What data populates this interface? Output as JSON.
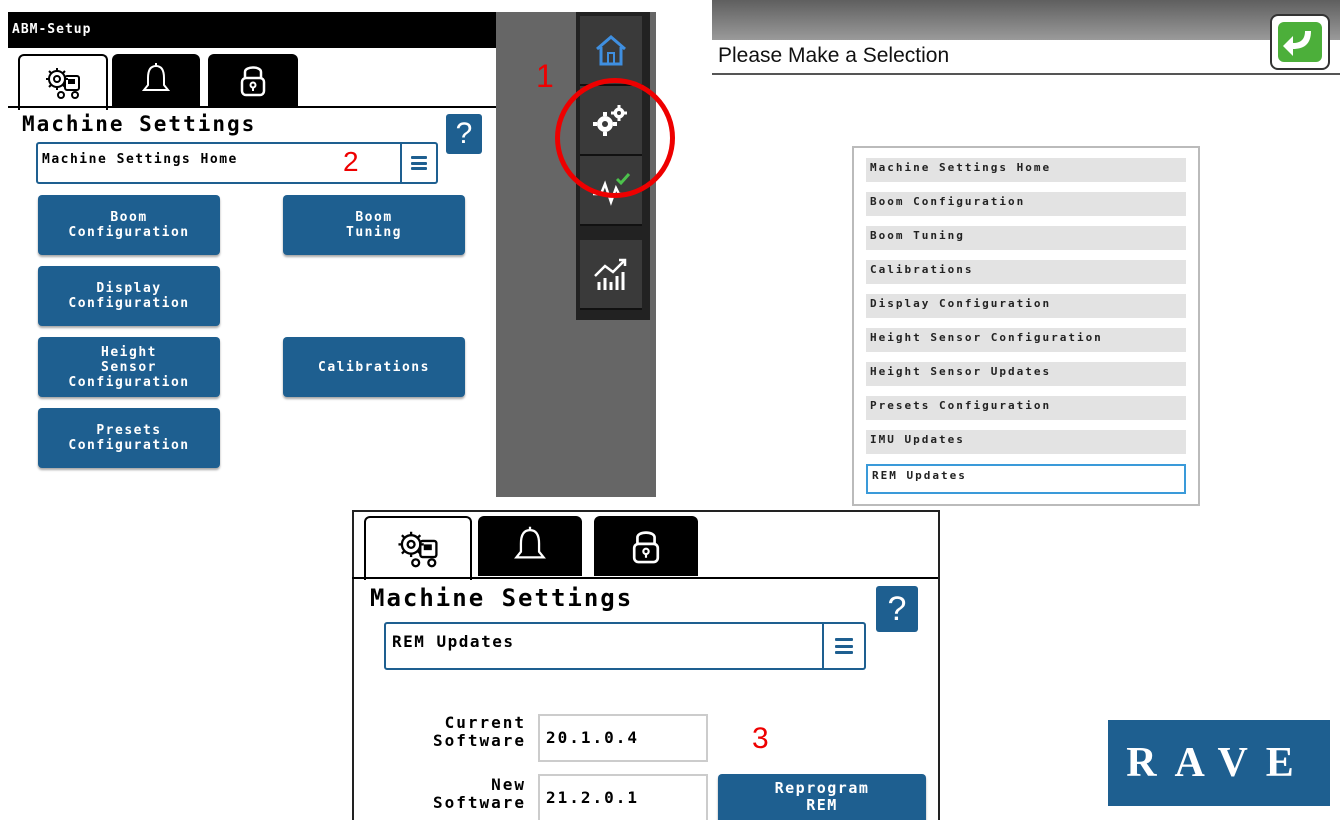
{
  "panel1": {
    "title": "ABM-Setup",
    "section_title": "Machine Settings",
    "help": "?",
    "selected_page": "Machine Settings Home",
    "step_label": "2",
    "buttons": [
      {
        "label": "Boom\nConfiguration"
      },
      {
        "label": "Boom\nTuning"
      },
      {
        "label": "Display\nConfiguration"
      },
      {
        "label": "Height\nSensor\nConfiguration"
      },
      {
        "label": "Calibrations"
      },
      {
        "label": "Presets\nConfiguration"
      }
    ],
    "tabs": [
      "machine-settings-icon",
      "bell-icon",
      "lock-icon"
    ]
  },
  "rail": {
    "items": [
      "home-icon",
      "gears-icon",
      "diagnostics-icon",
      "chart-icon"
    ],
    "step_label": "1",
    "accent": "#e00000"
  },
  "panel2": {
    "title": "Please Make a Selection",
    "back": "back-arrow-icon",
    "items": [
      "Machine Settings Home",
      "Boom Configuration",
      "Boom Tuning",
      "Calibrations",
      "Display Configuration",
      "Height Sensor Configuration",
      "Height Sensor Updates",
      "Presets Configuration",
      "IMU Updates",
      "REM Updates"
    ],
    "selected_index": 9
  },
  "panel3": {
    "section_title": "Machine Settings",
    "help": "?",
    "selected_page": "REM Updates",
    "current_label": "Current\nSoftware",
    "current_value": "20.1.0.4",
    "new_label": "New\nSoftware",
    "new_value": "21.2.0.1",
    "reprogram_label": "Reprogram\nREM",
    "step_label": "3"
  },
  "logo": {
    "text": "RAVE"
  },
  "colors": {
    "button_blue": "#1e5f90",
    "marker_red": "#e00000",
    "selection_border": "#3a9ad9"
  }
}
